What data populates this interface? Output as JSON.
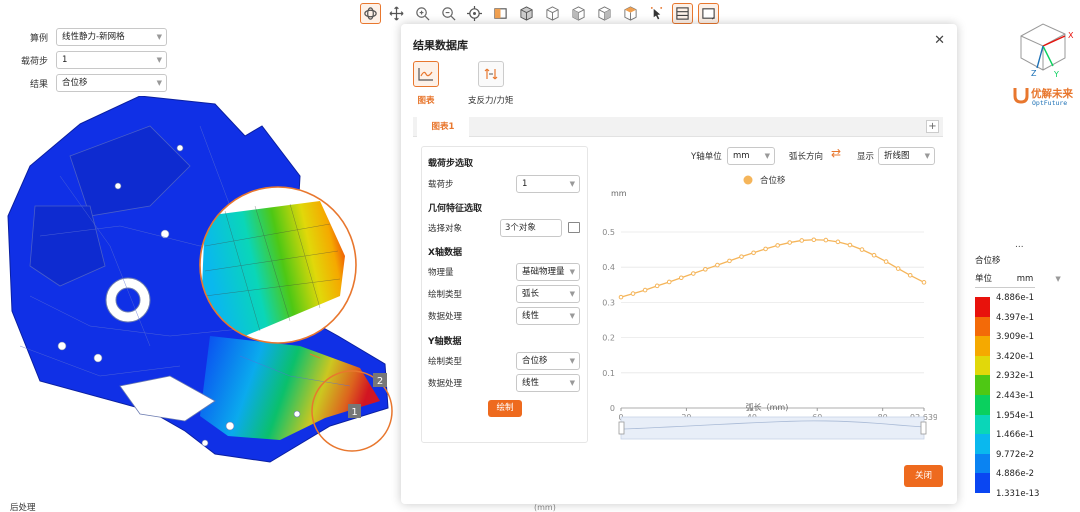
{
  "toolbar": {
    "items": [
      {
        "icon": "rotate-icon",
        "active": true
      },
      {
        "icon": "pan-icon"
      },
      {
        "icon": "zoom-in-icon"
      },
      {
        "icon": "zoom-out-icon"
      },
      {
        "icon": "fit-target-icon"
      },
      {
        "icon": "section-view-icon"
      },
      {
        "icon": "iso-view-icon"
      },
      {
        "icon": "front-view-icon"
      },
      {
        "icon": "back-view-icon"
      },
      {
        "icon": "left-view-icon"
      },
      {
        "icon": "right-view-icon"
      },
      {
        "icon": "pick-cursor-icon"
      },
      {
        "icon": "clip-plane-icon",
        "active": true
      },
      {
        "icon": "display-mode-icon",
        "active": true
      }
    ]
  },
  "left_panel": {
    "case_label": "算例",
    "case_value": "线性静力-新网格",
    "step_label": "载荷步",
    "step_value": "1",
    "result_label": "结果",
    "result_value": "合位移"
  },
  "model": {
    "node_labels": [
      "1",
      "2"
    ]
  },
  "footer": {
    "post_label": "后处理",
    "unit_fragment": "(mm)"
  },
  "dialog": {
    "title": "结果数据库",
    "tab_chart": "图表",
    "tab_reaction": "支反力/力矩",
    "subtab": "图表1",
    "add": "+",
    "close_label": "关闭"
  },
  "settings": {
    "step_section": "载荷步选取",
    "step_label": "载荷步",
    "step_value": "1",
    "geo_section": "几何特征选取",
    "select_label": "选择对象",
    "select_value": "3个对象",
    "x_section": "X轴数据",
    "x_quantity_label": "物理量",
    "x_quantity_value": "基础物理量",
    "x_plot_type_label": "绘制类型",
    "x_plot_type_value": "弧长",
    "x_process_label": "数据处理",
    "x_process_value": "线性",
    "y_section": "Y轴数据",
    "y_plot_type_label": "绘制类型",
    "y_plot_type_value": "合位移",
    "y_process_label": "数据处理",
    "y_process_value": "线性",
    "draw_label": "绘制"
  },
  "chart_controls": {
    "y_unit_label": "Y轴单位",
    "y_unit_value": "mm",
    "arc_dir_label": "弧长方向",
    "show_label": "显示",
    "show_value": "折线图"
  },
  "chart_data": {
    "type": "line",
    "series": [
      {
        "name": "合位移",
        "x": [
          0,
          3.68,
          7.37,
          11.05,
          14.74,
          18.42,
          22.11,
          25.79,
          29.47,
          33.16,
          36.84,
          40.53,
          44.21,
          47.89,
          51.58,
          55.26,
          58.95,
          62.63,
          66.32,
          70.0,
          73.68,
          77.37,
          81.05,
          84.74,
          88.42,
          92.639
        ],
        "y": [
          0.315,
          0.325,
          0.335,
          0.347,
          0.358,
          0.37,
          0.382,
          0.394,
          0.406,
          0.418,
          0.43,
          0.441,
          0.452,
          0.462,
          0.47,
          0.476,
          0.478,
          0.477,
          0.472,
          0.463,
          0.45,
          0.434,
          0.416,
          0.396,
          0.377,
          0.357
        ]
      }
    ],
    "ylabel": "mm",
    "xlabel": "弧长（mm)",
    "xlim": [
      0,
      92.639
    ],
    "ylim": [
      0,
      0.5
    ],
    "yticks": [
      "0",
      "0.1",
      "0.2",
      "0.3",
      "0.4",
      "0.5"
    ],
    "xticks": [
      "0",
      "20",
      "40",
      "60",
      "80",
      "92.639"
    ],
    "grid": true,
    "legend": "top-center",
    "color": "#f5b55a"
  },
  "logo": {
    "name": "优解未来",
    "sub": "OptFuture",
    "axes": [
      "X",
      "Y",
      "Z"
    ]
  },
  "legend_panel": {
    "title": "合位移",
    "more": "...",
    "unit_label": "单位",
    "unit_value": "mm",
    "values": [
      "4.886e-1",
      "4.397e-1",
      "3.909e-1",
      "3.420e-1",
      "2.932e-1",
      "2.443e-1",
      "1.954e-1",
      "1.466e-1",
      "9.772e-2",
      "4.886e-2",
      "1.331e-13"
    ],
    "colors": [
      "#e8120c",
      "#f36a08",
      "#f5a900",
      "#e1d80a",
      "#4ec814",
      "#0ad05e",
      "#0ad6b8",
      "#0ab8ee",
      "#0a83f2",
      "#0a46f2"
    ]
  }
}
